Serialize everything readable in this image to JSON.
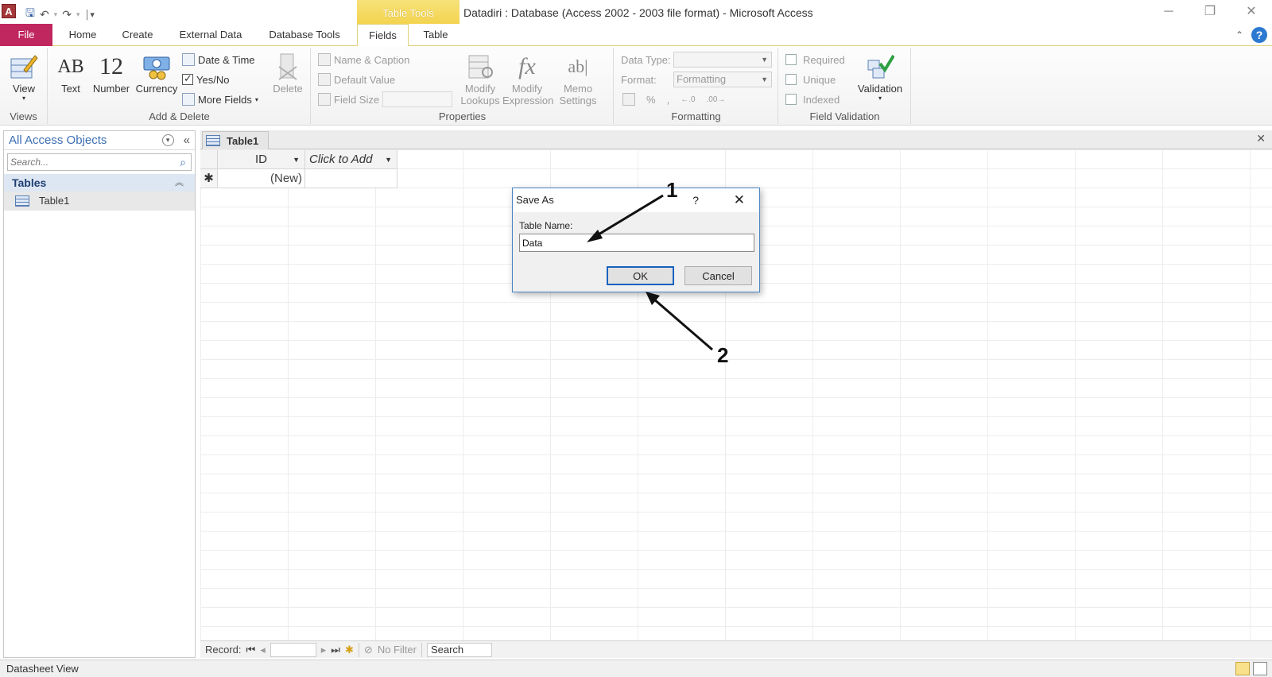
{
  "titlebar": {
    "app_icon": "A",
    "contextual_tab": "Table Tools",
    "title": "Datadiri : Database (Access 2002 - 2003 file format)  -  Microsoft Access"
  },
  "tabs": [
    "File",
    "Home",
    "Create",
    "External Data",
    "Database Tools",
    "Fields",
    "Table"
  ],
  "ribbon": {
    "views": {
      "view_label": "View",
      "group_label": "Views"
    },
    "add_delete": {
      "text": "Text",
      "number": "Number",
      "currency": "Currency",
      "date_time": "Date & Time",
      "yes_no": "Yes/No",
      "more_fields": "More Fields",
      "delete": "Delete",
      "group_label": "Add & Delete",
      "text_glyph": "AB",
      "number_glyph": "12"
    },
    "properties": {
      "name_caption": "Name & Caption",
      "default_value": "Default Value",
      "field_size": "Field Size",
      "modify_lookups": "Modify Lookups",
      "modify_expression": "Modify Expression",
      "memo_settings": "Memo Settings",
      "group_label": "Properties",
      "fx_glyph": "fx",
      "ab_glyph": "ab|"
    },
    "formatting": {
      "data_type_label": "Data Type:",
      "format_label": "Format:",
      "format_value": "Formatting",
      "percent": "%",
      "comma": ",",
      "inc_dec": "←.0",
      "dec_dec": ".00→",
      "group_label": "Formatting"
    },
    "field_validation": {
      "required": "Required",
      "unique": "Unique",
      "indexed": "Indexed",
      "validation": "Validation",
      "group_label": "Field Validation"
    }
  },
  "nav": {
    "header": "All Access Objects",
    "search_placeholder": "Search...",
    "group": "Tables",
    "items": [
      {
        "label": "Table1"
      }
    ]
  },
  "document": {
    "tab_label": "Table1",
    "columns": [
      "ID",
      "Click to Add"
    ],
    "new_row": {
      "selector": "✱",
      "id": "(New)"
    }
  },
  "record_bar": {
    "record_label": "Record:",
    "no_filter": "No Filter",
    "search_value": "Search"
  },
  "status": {
    "text": "Datasheet View"
  },
  "dialog": {
    "title": "Save As",
    "help": "?",
    "field_label": "Table Name:",
    "field_value": "Data",
    "ok": "OK",
    "cancel": "Cancel"
  },
  "annotations": [
    "1",
    "2"
  ],
  "colors": {
    "file_tab": "#c0275e",
    "table_tools": "#f3d34f",
    "nav_accent": "#3c6fb3",
    "dialog_border": "#4a84c4"
  }
}
